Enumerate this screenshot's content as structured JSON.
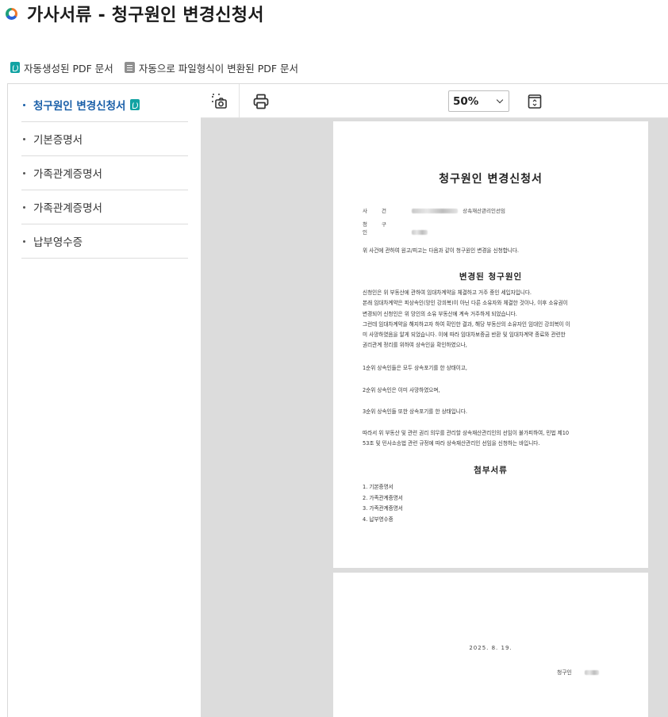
{
  "header": {
    "title": "가사서류 - 청구원인 변경신청서"
  },
  "legend": {
    "auto_pdf_label": "자동생성된 PDF 문서",
    "converted_pdf_label": "자동으로 파일형식이 변환된 PDF 문서"
  },
  "sidebar": {
    "items": [
      {
        "label": "청구원인 변경신청서",
        "active": true,
        "icon": "pdf-icon"
      },
      {
        "label": "기본증명서"
      },
      {
        "label": "가족관계증명서"
      },
      {
        "label": "가족관계증명서"
      },
      {
        "label": "납부영수증"
      }
    ]
  },
  "toolbar": {
    "capture_icon": "capture-icon",
    "print_icon": "print-icon",
    "zoom_value": "50%",
    "fit_icon": "fit-page-icon"
  },
  "document": {
    "title": "청구원인 변경신청서",
    "case_label": "사 건",
    "case_suffix": "상속재산관리인선임",
    "claimant_label": "청 구 인",
    "intro": "위 사건에 관하여 원고/피고는 다음과 같이 청구원인 변경을 신청합니다.",
    "changed_heading": "변경된 청구원인",
    "body_lines": [
      "신청인은 위 부동산에 관하여 임대차계약을 체결하고 거주 중인 세입자입니다.",
      "본래 임대차계약은 피상속인(망인 강희복)이 아닌 다른 소유자와 체결한 것이나, 이후 소유권이",
      "변경되어 신청인은 위 망인의 소유 부동산에 계속 거주하게 되었습니다.",
      "그런데 임대차계약을 해지하고자 하여 확인한 결과, 해당 부동산의 소유자인 임대인 강희복이 이",
      "미 사망하였음을 알게 되었습니다. 이에 따라 임대차보증금 반환 및 임대차계약 종료와 관련한",
      "권리관계 정리를 위하여 상속인을 확인하였으나,"
    ],
    "line_first": "1순위 상속인들은 모두 상속포기를 한 상태이고,",
    "line_second": "2순위 상속인은 이미 사망하였으며,",
    "line_third": "3순위 상속인들 또한 상속포기를 한 상태입니다.",
    "conclusion_lines": [
      "따라서 위 부동산 및 관련 권리 의무를 관리할 상속재산관리인의 선임이 불가피하여, 민법 제10",
      "53조 및 민사소송법 관련 규정에 따라 상속재산관리인 선임을 신청하는 바입니다."
    ],
    "attachments_heading": "첨부서류",
    "attachments": [
      "1. 기본증명서",
      "2. 가족관계증명서",
      "3. 가족관계증명서",
      "4. 납부영수증"
    ],
    "date": "2025.  8.  19.",
    "signer_label": "청구인"
  }
}
